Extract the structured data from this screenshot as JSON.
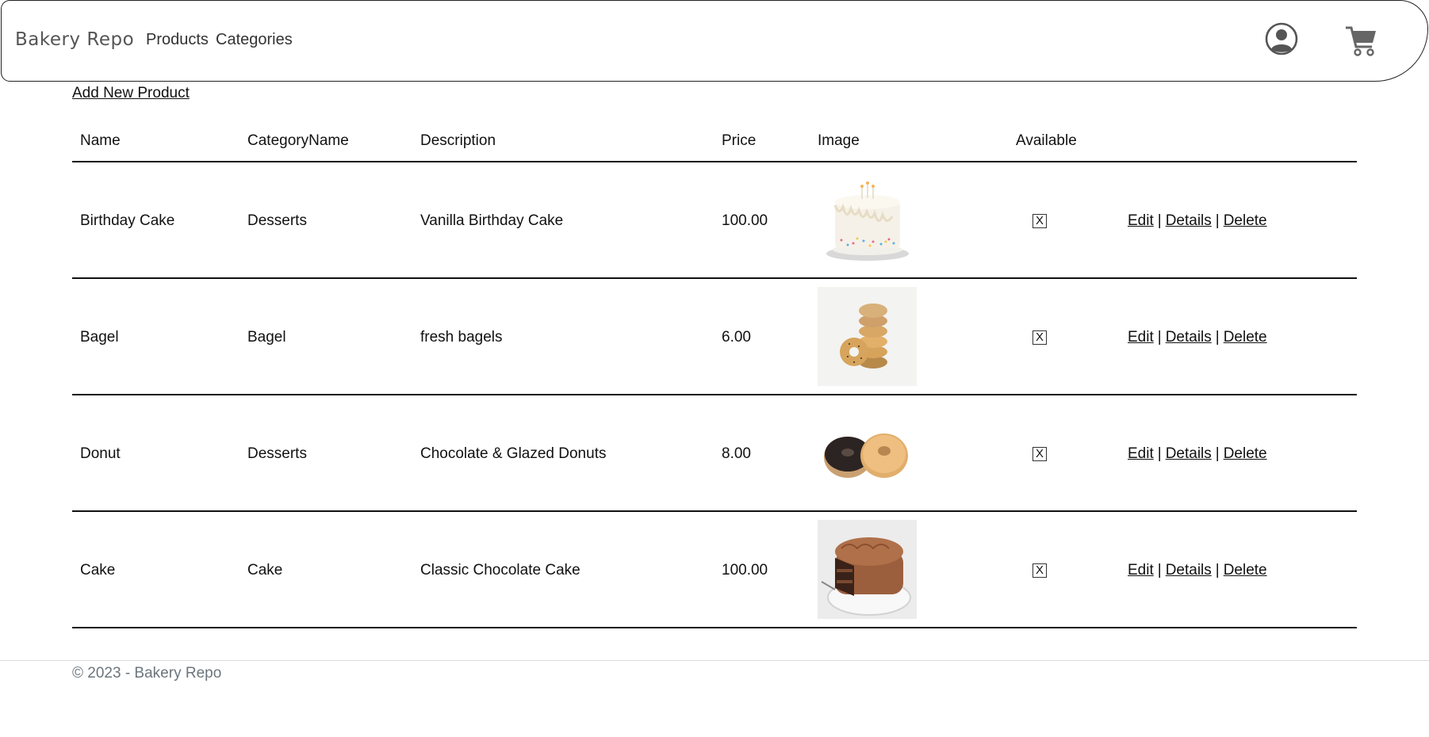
{
  "nav": {
    "brand": "Bakery Repo",
    "links": [
      {
        "label": "Products"
      },
      {
        "label": "Categories"
      }
    ],
    "user_icon": "user-circle-icon",
    "cart_icon": "shopping-cart-icon"
  },
  "add_new_product": "Add New Product",
  "table": {
    "headers": [
      "Name",
      "CategoryName",
      "Description",
      "Price",
      "Image",
      "Available"
    ],
    "rows": [
      {
        "name": "Birthday Cake",
        "category": "Desserts",
        "description": "Vanilla Birthday Cake",
        "price": "100.00",
        "available": "X",
        "image": "birthday-cake-image"
      },
      {
        "name": "Bagel",
        "category": "Bagel",
        "description": "fresh bagels",
        "price": "6.00",
        "available": "X",
        "image": "bagel-stack-image"
      },
      {
        "name": "Donut",
        "category": "Desserts",
        "description": "Chocolate & Glazed Donuts",
        "price": "8.00",
        "available": "X",
        "image": "donuts-image"
      },
      {
        "name": "Cake",
        "category": "Cake",
        "description": "Classic Chocolate Cake",
        "price": "100.00",
        "available": "X",
        "image": "chocolate-cake-image"
      }
    ],
    "actions": {
      "edit": "Edit",
      "details": "Details",
      "delete": "Delete",
      "separator": "|"
    }
  },
  "footer": "© 2023 - Bakery Repo"
}
